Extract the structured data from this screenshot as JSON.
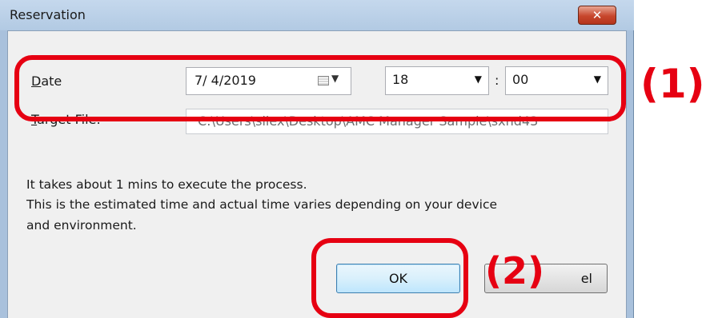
{
  "window": {
    "title": "Reservation",
    "close_glyph": "✕"
  },
  "form": {
    "date_label_accel": "D",
    "date_label_rest": "ate",
    "date_value": "7/  4/2019",
    "date_picker_icon": "calendar-icon",
    "hour_value": "18",
    "time_separator": ":",
    "minute_value": "00",
    "target_label_accel": "T",
    "target_label_rest": "arget File:",
    "target_value": "C:\\Users\\silex\\Desktop\\AMC Manager Sample\\sxnd43"
  },
  "message": {
    "line1": "It takes about 1 mins to execute the process.",
    "line2": "This is the estimated time and actual time varies depending on your device",
    "line3": "and environment."
  },
  "buttons": {
    "ok": "OK",
    "cancel_visible_fragment": "el"
  },
  "callouts": {
    "one": "(1)",
    "two": "(2)"
  },
  "colors": {
    "callout": "#e60012",
    "titlebar": "#b9cfe7",
    "close": "#c7462c"
  }
}
